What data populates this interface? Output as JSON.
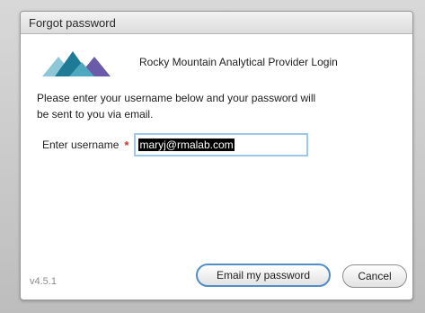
{
  "dialog": {
    "title": "Forgot password",
    "header_text": "Rocky Mountain Analytical Provider Login",
    "instructions": "Please enter your username below and your password will be sent to you via email.",
    "username_label": "Enter username",
    "required_marker": "*",
    "username_value": "maryj@rmalab.com",
    "version": "v4.5.1",
    "email_button_label": "Email my password",
    "cancel_button_label": "Cancel"
  },
  "colors": {
    "logo_dark": "#1f7a96",
    "logo_light": "#8ec7d8",
    "logo_purple": "#6b5aa8",
    "required": "#d0302e",
    "focus_border": "#4f8ec9"
  },
  "icons": {
    "logo": "mountain-logo-icon"
  }
}
